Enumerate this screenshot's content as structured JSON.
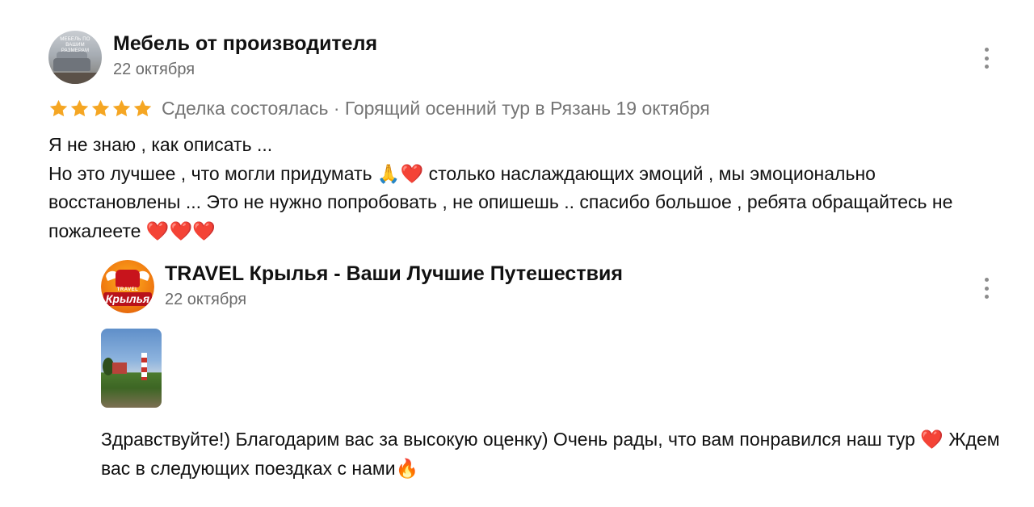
{
  "review": {
    "author_name": "Мебель от производителя",
    "avatar_text": "МЕБЕЛЬ ПО ВАШИМ РАЗМЕРАМ",
    "date": "22 октября",
    "rating": 5,
    "rating_max": 5,
    "star_color": "#f5a623",
    "meta": "Сделка состоялась · Горящий осенний тур в Рязань 19 октября",
    "text_lines": [
      "Я не знаю , как описать ...",
      "Но это лучшее , что могли придумать 🙏❤️ столько наслаждающих эмоций , мы эмоционально восстановлены ... Это не нужно попробовать , не опишешь .. спасибо большое , ребята обращайтесь не пожалеете ❤️❤️❤️"
    ]
  },
  "reply": {
    "author_name": "TRAVEL Крылья - Ваши Лучшие Путешествия",
    "avatar_logo_top": "TRAVEL",
    "avatar_logo_name": "Крылья",
    "date": "22 октября",
    "text": "Здравствуйте!) Благодарим вас за высокую оценку) Очень рады, что вам понравился наш тур ❤️ Ждем вас в следующих поездках с нами🔥"
  },
  "icons": {
    "more": "more-vertical-icon",
    "star": "star-icon",
    "photo": "photo-thumbnail"
  }
}
